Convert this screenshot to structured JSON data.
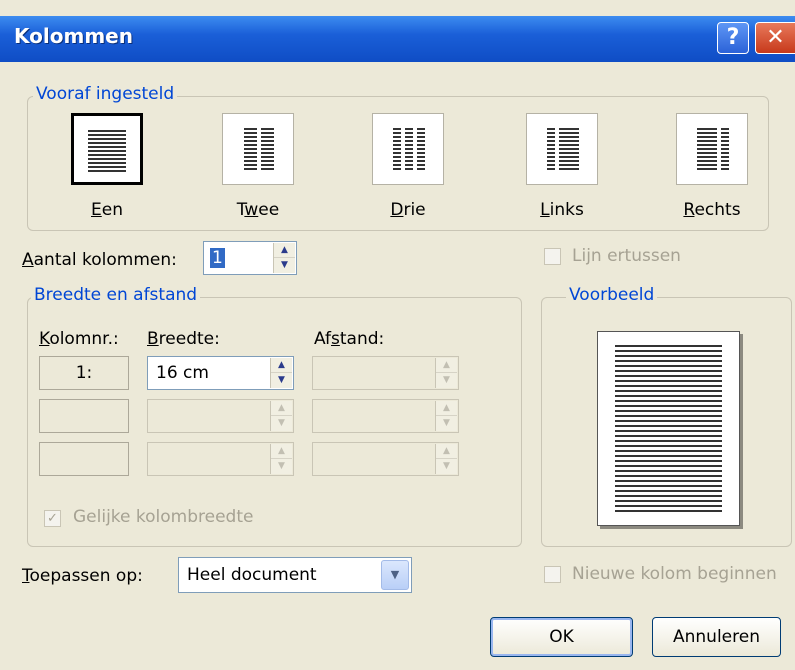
{
  "window": {
    "title": "Kolommen",
    "help_label": "?",
    "close_label": "✕"
  },
  "presets": {
    "group_label": "Vooraf ingesteld",
    "items": [
      {
        "label_ul": "E",
        "label_rest": "en"
      },
      {
        "label_pre": "T",
        "label_ul": "w",
        "label_rest": "ee"
      },
      {
        "label_ul": "D",
        "label_rest": "rie"
      },
      {
        "label_ul": "L",
        "label_rest": "inks"
      },
      {
        "label_ul": "R",
        "label_rest": "echts"
      }
    ]
  },
  "columns_count": {
    "label_ul": "A",
    "label_rest": "antal kolommen:",
    "value": "1"
  },
  "line_between": {
    "label": "Lijn ertussen"
  },
  "width_spacing": {
    "group_label": "Breedte en afstand",
    "col_header_ul": "K",
    "col_header_rest": "olomnr.:",
    "width_header_ul": "B",
    "width_header_rest": "reedte:",
    "spacing_header_pre": "Af",
    "spacing_header_ul": "s",
    "spacing_header_rest": "tand:",
    "rows": [
      {
        "col": "1:",
        "width": "16 cm",
        "spacing": ""
      },
      {
        "col": "",
        "width": "",
        "spacing": ""
      },
      {
        "col": "",
        "width": "",
        "spacing": ""
      }
    ],
    "equal_width_label": "Gelijke kolombreedte",
    "equal_width_check": "✓"
  },
  "preview": {
    "group_label": "Voorbeeld"
  },
  "apply_to": {
    "label_ul": "T",
    "label_rest": "oepassen op:",
    "value": "Heel document",
    "arrow": "▼"
  },
  "new_column": {
    "label": "Nieuwe kolom beginnen"
  },
  "buttons": {
    "ok": "OK",
    "cancel": "Annuleren"
  },
  "spin_glyphs": {
    "up": "▲",
    "down": "▼"
  }
}
